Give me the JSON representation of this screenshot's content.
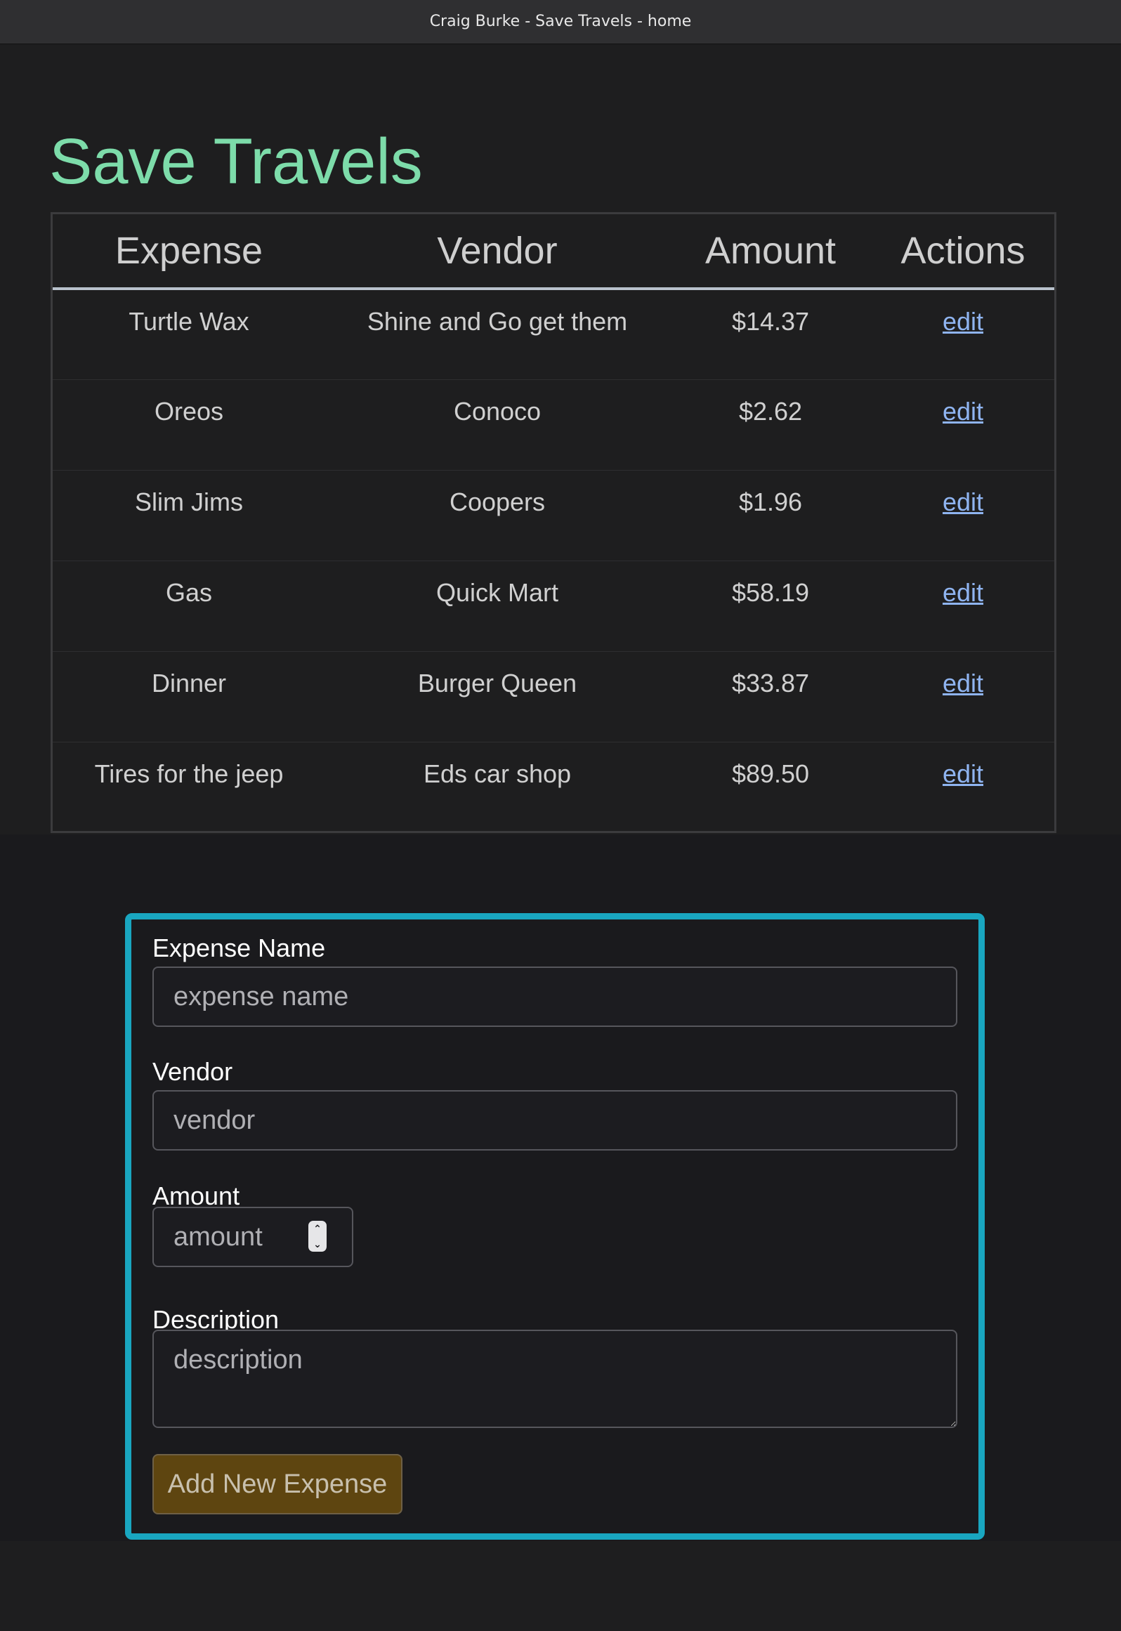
{
  "window": {
    "title": "Craig Burke - Save Travels - home"
  },
  "page": {
    "heading": "Save Travels"
  },
  "table": {
    "headers": {
      "expense": "Expense",
      "vendor": "Vendor",
      "amount": "Amount",
      "actions": "Actions"
    },
    "rows": [
      {
        "expense": "Turtle Wax",
        "vendor": "Shine and Go get them",
        "amount": "$14.37",
        "action": "edit"
      },
      {
        "expense": "Oreos",
        "vendor": "Conoco",
        "amount": "$2.62",
        "action": "edit"
      },
      {
        "expense": "Slim Jims",
        "vendor": "Coopers",
        "amount": "$1.96",
        "action": "edit"
      },
      {
        "expense": "Gas",
        "vendor": "Quick Mart",
        "amount": "$58.19",
        "action": "edit"
      },
      {
        "expense": "Dinner",
        "vendor": "Burger Queen",
        "amount": "$33.87",
        "action": "edit"
      },
      {
        "expense": "Tires for the jeep",
        "vendor": "Eds car shop",
        "amount": "$89.50",
        "action": "edit"
      }
    ]
  },
  "form": {
    "expense_name": {
      "label": "Expense Name",
      "placeholder": "expense name",
      "value": ""
    },
    "vendor": {
      "label": "Vendor",
      "placeholder": "vendor",
      "value": ""
    },
    "amount": {
      "label": "Amount",
      "placeholder": "amount",
      "value": ""
    },
    "description": {
      "label": "Description",
      "placeholder": "description",
      "value": ""
    },
    "submit_label": "Add New Expense"
  },
  "colors": {
    "heading": "#7ddcaa",
    "form_border": "#19a6c0",
    "submit_bg": "#5e4510",
    "link": "#8fb4f0"
  },
  "icons": {
    "amount_spinner": "spinner-arrows-icon"
  }
}
